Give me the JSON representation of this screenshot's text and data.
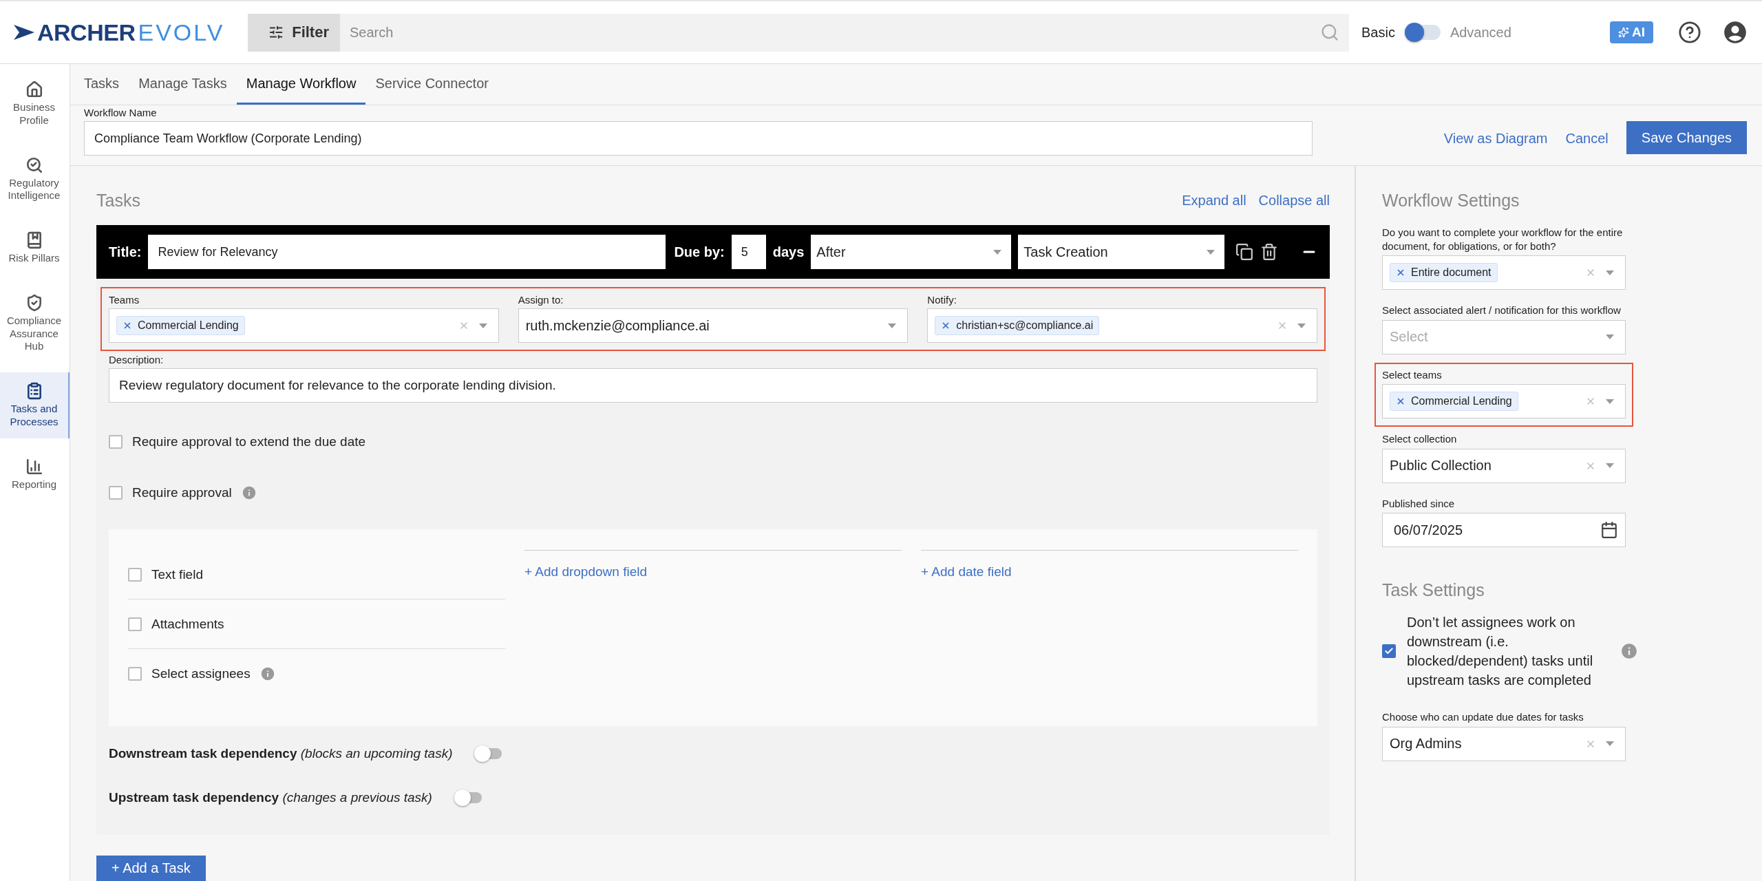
{
  "header": {
    "logo": {
      "brand": "ARCHER",
      "product": "EVOLV"
    },
    "filter_button": "Filter",
    "search": {
      "placeholder": "Search"
    },
    "mode_toggle": {
      "left": "Basic",
      "right": "Advanced",
      "on": false
    },
    "ai_button": "AI"
  },
  "sidebar": {
    "items": [
      {
        "label": "Business Profile",
        "kind": "house",
        "selected": false
      },
      {
        "label": "Regulatory Intelligence",
        "kind": "magnifier",
        "selected": false
      },
      {
        "label": "Risk Pillars",
        "kind": "book",
        "selected": false
      },
      {
        "label": "Compliance Assurance Hub",
        "kind": "shield",
        "selected": false
      },
      {
        "label": "Tasks and Processes",
        "kind": "clipboard",
        "selected": true
      },
      {
        "label": "Reporting",
        "kind": "chart",
        "selected": false
      }
    ]
  },
  "tabs": [
    {
      "label": "Tasks",
      "selected": false
    },
    {
      "label": "Manage Tasks",
      "selected": false
    },
    {
      "label": "Manage Workflow",
      "selected": true
    },
    {
      "label": "Service Connector",
      "selected": false
    }
  ],
  "workflow_name": {
    "label": "Workflow Name",
    "value": "Compliance Team Workflow (Corporate Lending)"
  },
  "actions": {
    "links": [
      "View as Diagram",
      "Cancel"
    ],
    "save_button": "Save Changes"
  },
  "tasks": {
    "heading": "Tasks",
    "expand_all": "Expand all",
    "collapse_all": "Collapse all"
  },
  "task": {
    "title_label": "Title:",
    "title": "Review for Relevancy",
    "due_label": "Due by:",
    "due_value": "5",
    "days_label": "days",
    "timing": "After",
    "anchor": "Task Creation",
    "assignment_highlighted": true,
    "assignment_fields": [
      {
        "label": "Teams",
        "kind": "chips",
        "chips": [
          "Commercial Lending"
        ]
      },
      {
        "label": "Assign to:",
        "kind": "select",
        "value": "ruth.mckenzie@compliance.ai"
      },
      {
        "label": "Notify:",
        "kind": "chips",
        "chips": [
          "christian+sc@compliance.ai"
        ]
      }
    ],
    "description": {
      "label": "Description:",
      "value": "Review regulatory document for relevance to the corporate lending division."
    },
    "options": [
      {
        "label": "Require approval to extend the due date",
        "checked": false,
        "info": false
      },
      {
        "label": "Require approval",
        "checked": false,
        "info": true
      }
    ],
    "custom_fields": {
      "checkboxes": [
        {
          "label": "Text field",
          "checked": false,
          "info": false
        },
        {
          "label": "Attachments",
          "checked": false,
          "info": false
        },
        {
          "label": "Select assignees",
          "checked": false,
          "info": true
        }
      ],
      "links": [
        "+ Add dropdown field",
        "+ Add date field"
      ]
    },
    "dependencies": [
      {
        "label": "**Downstream task dependency** *(blocks an upcoming task)*",
        "on": false
      },
      {
        "label": "**Upstream task dependency** *(changes a previous task)*",
        "on": false
      }
    ]
  },
  "add_task_button": "+ Add a Task",
  "workflow_settings": {
    "heading": "Workflow Settings",
    "fields": [
      {
        "label": "Do you want to complete your workflow for the entire document, for obligations, or for both?",
        "kind": "chips",
        "chips": [
          "Entire document"
        ],
        "highlighted": false
      },
      {
        "label": "Select associated alert / notification for this workflow",
        "kind": "select",
        "placeholder": "Select",
        "highlighted": false
      },
      {
        "label": "Select teams",
        "kind": "chips",
        "chips": [
          "Commercial Lending"
        ],
        "highlighted": true
      },
      {
        "label": "Select collection",
        "kind": "select",
        "value": "Public Collection",
        "highlighted": false
      },
      {
        "label": "Published since",
        "kind": "date",
        "value": "06/07/2025",
        "highlighted": false
      }
    ]
  },
  "task_settings": {
    "heading": "Task Settings",
    "checkbox": {
      "label": "Don’t let assignees work on downstream (i.e. blocked/dependent) tasks until upstream tasks are completed",
      "checked": true
    },
    "due_date_field": {
      "label": "Choose who can update due dates for tasks",
      "value": "Org Admins"
    }
  }
}
